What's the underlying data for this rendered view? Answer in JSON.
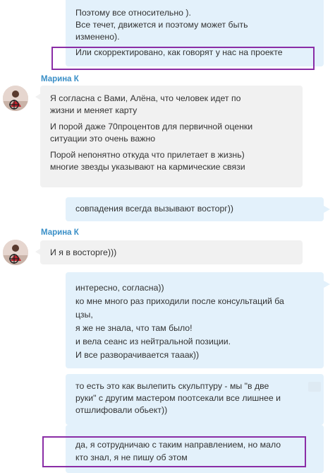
{
  "chat": {
    "msg1": {
      "lines": [
        "Поэтому все относительно ).",
        "Все течет, движется и поэтому может быть",
        "изменено).",
        "Или скорректировано, как говорят у нас на проекте"
      ]
    },
    "sender1": "Марина К",
    "msg2": {
      "lines": [
        "Я согласна с Вами, Алёна, что человек идет по",
        "жизни и меняет карту",
        "И порой даже 70процентов для первичной оценки",
        "ситуации это очень важно",
        "Порой непонятно откуда что прилетает в жизнь)",
        "многие звезды указывают на кармические связи"
      ]
    },
    "msg3": {
      "lines": [
        "совпадения всегда вызывают восторг))"
      ]
    },
    "sender2": "Марина К",
    "msg4": {
      "lines": [
        "И я в восторге)))"
      ]
    },
    "msg5": {
      "lines": [
        "интересно, согласна))",
        "ко мне много раз приходили после консультаций ба",
        "цзы,",
        "я же не знала, что там было!",
        "и вела сеанс из нейтральной позиции.",
        "И все разворачивается тааак))"
      ]
    },
    "msg6": {
      "lines": [
        "то есть это как вылепить скульптуру - мы \"в две",
        "руки\" с другим мастером поотсекали все лишнее и",
        "отшлифовали обьект))"
      ]
    },
    "msg7": {
      "lines": [
        "да, я сотрудничаю с таким направлением, но мало",
        "кто знал, я не пишу об этом"
      ]
    }
  },
  "colors": {
    "outgoing_bubble": "#e3f1fb",
    "incoming_bubble": "#f1f1f1",
    "sender_name": "#3a8fc7",
    "highlight_box": "#8a2da6"
  }
}
